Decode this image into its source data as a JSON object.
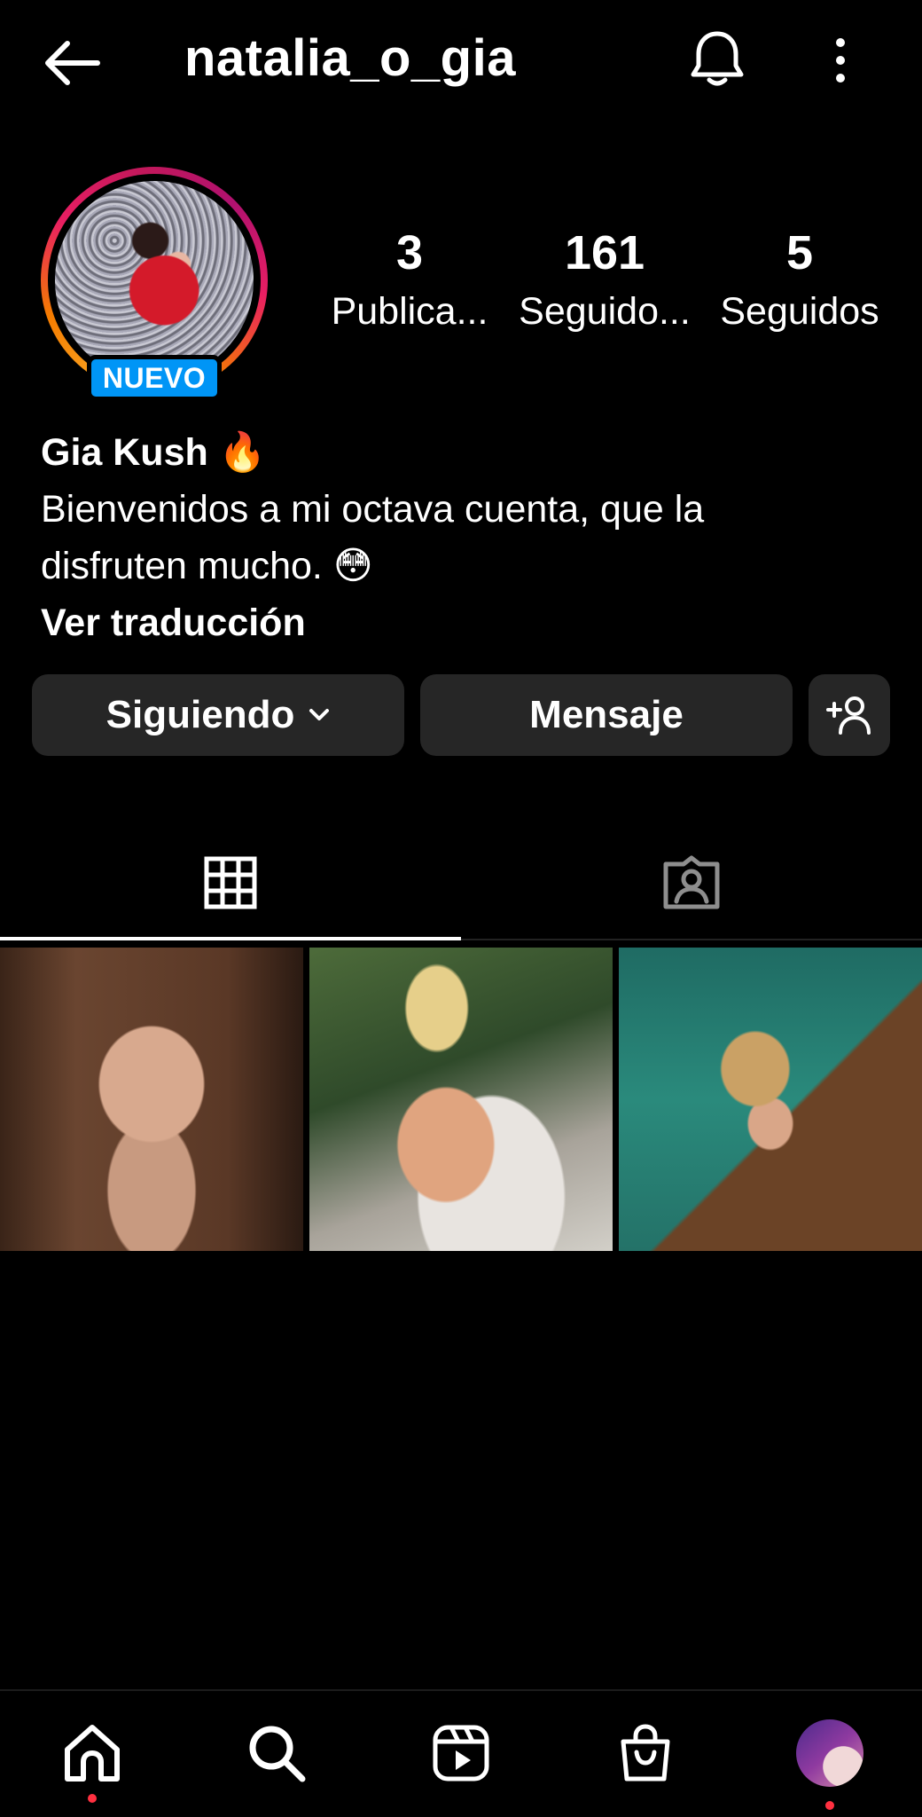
{
  "header": {
    "username": "natalia_o_gia",
    "back_icon": "arrow-left-icon",
    "bell_icon": "bell-icon",
    "more_icon": "more-vertical-icon"
  },
  "profile": {
    "new_badge": "NUEVO",
    "stats": [
      {
        "value": "3",
        "label": "Publica..."
      },
      {
        "value": "161",
        "label": "Seguido..."
      },
      {
        "value": "5",
        "label": "Seguidos"
      }
    ],
    "display_name": "Gia Kush 🔥",
    "bio_line1": "Bienvenidos a mi octava cuenta, que la",
    "bio_line2": "disfruten mucho. 😳",
    "translate_link": "Ver traducción"
  },
  "actions": {
    "following_label": "Siguiendo",
    "message_label": "Mensaje",
    "suggest_icon": "add-person-icon"
  },
  "tabs": [
    {
      "name": "grid",
      "icon": "grid-icon",
      "active": true
    },
    {
      "name": "tagged",
      "icon": "tagged-person-icon",
      "active": false
    }
  ],
  "posts": [
    {
      "subject": "selfie portrait"
    },
    {
      "subject": "bikini by hot tub"
    },
    {
      "subject": "woman with straw hat in water by dock"
    }
  ],
  "bottom_nav": [
    {
      "name": "home",
      "icon": "home-icon"
    },
    {
      "name": "search",
      "icon": "search-icon"
    },
    {
      "name": "reels",
      "icon": "reels-icon"
    },
    {
      "name": "shop",
      "icon": "shop-bag-icon"
    },
    {
      "name": "profile",
      "icon": "profile-avatar"
    }
  ],
  "colors": {
    "background": "#000000",
    "button_bg": "#262626",
    "badge_blue": "#0095f6",
    "notification_dot": "#ff3040"
  }
}
